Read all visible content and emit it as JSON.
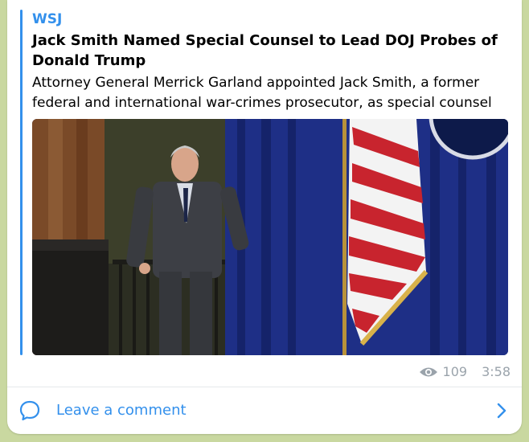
{
  "post": {
    "site_name": "WSJ",
    "headline": "Jack Smith Named Special Counsel to Lead DOJ Probes of Donald Trump",
    "description": "Attorney General Merrick Garland appointed Jack Smith, a former federal and international war-crimes prosecutor, as special counsel",
    "views": "109",
    "time": "3:58"
  },
  "footer": {
    "comment_label": "Leave a comment"
  },
  "icons": {
    "views": "eye-icon",
    "comment": "comment-bubble-icon",
    "chevron": "chevron-right-icon"
  },
  "colors": {
    "accent": "#3390ec",
    "meta": "#9aa3ab"
  }
}
